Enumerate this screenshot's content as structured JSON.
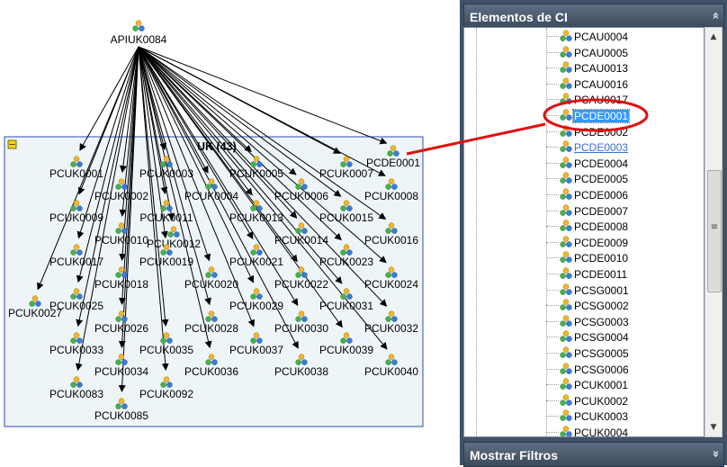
{
  "graph": {
    "root_label": "APIUK0084",
    "group_title": "UK (43)",
    "collapse_symbol": "−",
    "nodes": [
      "PCUK0001",
      "PCUK0002",
      "PCUK0003",
      "PCUK0004",
      "PCUK0005",
      "PCUK0006",
      "PCUK0007",
      "PCUK0008",
      "PCUK0009",
      "PCUK0010",
      "PCUK0011",
      "PCUK0012",
      "PCUK0013",
      "PCUK0014",
      "PCUK0015",
      "PCUK0016",
      "PCUK0017",
      "PCUK0018",
      "PCUK0019",
      "PCUK0020",
      "PCUK0021",
      "PCUK0022",
      "PCUK0023",
      "PCUK0024",
      "PCUK0025",
      "PCUK0026",
      "PCUK0027",
      "PCUK0028",
      "PCUK0029",
      "PCUK0030",
      "PCUK0031",
      "PCUK0032",
      "PCUK0033",
      "PCUK0034",
      "PCUK0035",
      "PCUK0036",
      "PCUK0037",
      "PCUK0038",
      "PCUK0039",
      "PCUK0040",
      "PCUK0083",
      "PCUK0085",
      "PCUK0092"
    ],
    "extra_node": "PCDE0001"
  },
  "panel": {
    "title": "Elementos de CI",
    "collapse_icon": "double-chevron-up",
    "collapse_glyph": "«",
    "footer_title": "Mostrar Filtros",
    "footer_icon": "double-chevron-down",
    "footer_glyph": "»"
  },
  "tree": {
    "items": [
      {
        "label": "PCAU0004",
        "state": "normal"
      },
      {
        "label": "PCAU0005",
        "state": "normal"
      },
      {
        "label": "PCAU0013",
        "state": "normal"
      },
      {
        "label": "PCAU0016",
        "state": "normal"
      },
      {
        "label": "PCAU0017",
        "state": "normal"
      },
      {
        "label": "PCDE0001",
        "state": "selected"
      },
      {
        "label": "PCDE0002",
        "state": "normal"
      },
      {
        "label": "PCDE0003",
        "state": "link"
      },
      {
        "label": "PCDE0004",
        "state": "normal"
      },
      {
        "label": "PCDE0005",
        "state": "normal"
      },
      {
        "label": "PCDE0006",
        "state": "normal"
      },
      {
        "label": "PCDE0007",
        "state": "normal"
      },
      {
        "label": "PCDE0008",
        "state": "normal"
      },
      {
        "label": "PCDE0009",
        "state": "normal"
      },
      {
        "label": "PCDE0010",
        "state": "normal"
      },
      {
        "label": "PCDE0011",
        "state": "normal"
      },
      {
        "label": "PCSG0001",
        "state": "normal"
      },
      {
        "label": "PCSG0002",
        "state": "normal"
      },
      {
        "label": "PCSG0003",
        "state": "normal"
      },
      {
        "label": "PCSG0004",
        "state": "normal"
      },
      {
        "label": "PCSG0005",
        "state": "normal"
      },
      {
        "label": "PCSG0006",
        "state": "normal"
      },
      {
        "label": "PCUK0001",
        "state": "normal"
      },
      {
        "label": "PCUK0002",
        "state": "normal"
      },
      {
        "label": "PCUK0003",
        "state": "normal"
      },
      {
        "label": "PCUK0004",
        "state": "normal"
      }
    ]
  },
  "scrollbar": {
    "up_glyph": "▲",
    "down_glyph": "▼",
    "grip_glyph": "≡"
  },
  "colors": {
    "group_bg": "#eef5f9",
    "group_border": "#2d4bb0",
    "callout": "#e01010",
    "selection": "#3399ff"
  }
}
